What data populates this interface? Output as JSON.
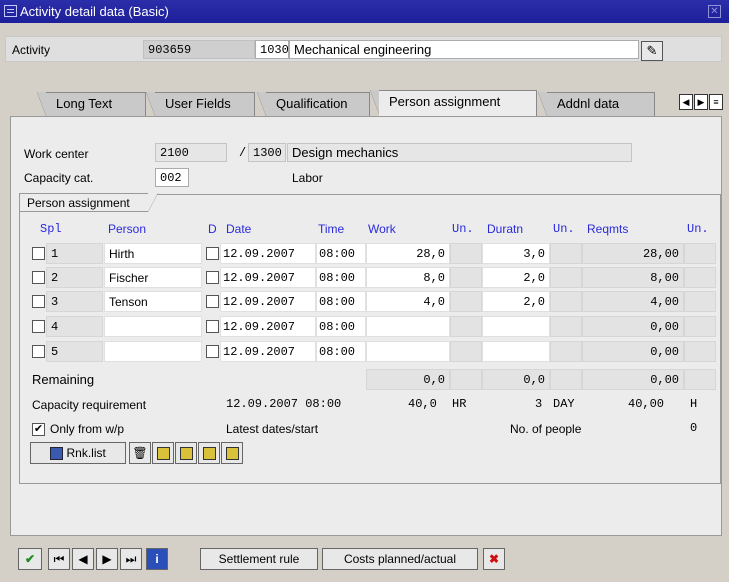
{
  "window": {
    "title": "Activity detail data (Basic)"
  },
  "activity": {
    "label": "Activity",
    "number": "903659",
    "operation": "1030",
    "description": "Mechanical engineering"
  },
  "tabs": [
    "Long Text",
    "User Fields",
    "Qualification",
    "Person assignment",
    "Addnl data"
  ],
  "active_tab": "Person assignment",
  "work_center": {
    "label": "Work center",
    "code": "2100",
    "sep": "/",
    "plant": "1300",
    "description": "Design mechanics"
  },
  "capacity_cat": {
    "label": "Capacity cat.",
    "code": "002",
    "description": "Labor"
  },
  "group_title": "Person assignment",
  "columns": {
    "spl": "Spl",
    "person": "Person",
    "d": "D",
    "date": "Date",
    "time": "Time",
    "work": "Work",
    "un1": "Un.",
    "duratn": "Duratn",
    "un2": "Un.",
    "reqmts": "Reqmts",
    "un3": "Un."
  },
  "rows": [
    {
      "spl": "1",
      "person": "Hirth",
      "date": "12.09.2007",
      "time": "08:00",
      "work": "28,0",
      "duratn": "3,0",
      "reqmts": "28,00"
    },
    {
      "spl": "2",
      "person": "Fischer",
      "date": "12.09.2007",
      "time": "08:00",
      "work": "8,0",
      "duratn": "2,0",
      "reqmts": "8,00"
    },
    {
      "spl": "3",
      "person": "Tenson",
      "date": "12.09.2007",
      "time": "08:00",
      "work": "4,0",
      "duratn": "2,0",
      "reqmts": "4,00"
    },
    {
      "spl": "4",
      "person": "",
      "date": "12.09.2007",
      "time": "08:00",
      "work": "",
      "duratn": "",
      "reqmts": "0,00"
    },
    {
      "spl": "5",
      "person": "",
      "date": "12.09.2007",
      "time": "08:00",
      "work": "",
      "duratn": "",
      "reqmts": "0,00"
    }
  ],
  "remaining": {
    "label": "Remaining",
    "work": "0,0",
    "duratn": "0,0",
    "reqmts": "0,00"
  },
  "capacity_req": {
    "label": "Capacity requirement",
    "datetime": "12.09.2007 08:00",
    "work": "40,0",
    "work_unit": "HR",
    "duration": "3",
    "duration_unit": "DAY",
    "reqmts": "40,00",
    "reqmts_unit": "H"
  },
  "only_wp": {
    "label": "Only from w/p",
    "checked": true
  },
  "latest": {
    "label": "Latest dates/start"
  },
  "people": {
    "label": "No. of people",
    "value": "0"
  },
  "toolbar": {
    "rnklist": "Rnk.list"
  },
  "bottom": {
    "settlement": "Settlement rule",
    "costs": "Costs planned/actual"
  },
  "icons": [
    "check-icon",
    "first-icon",
    "prev-icon",
    "next-icon",
    "last-icon",
    "info-icon",
    "cancel-icon",
    "trash-icon",
    "edit-icon"
  ]
}
